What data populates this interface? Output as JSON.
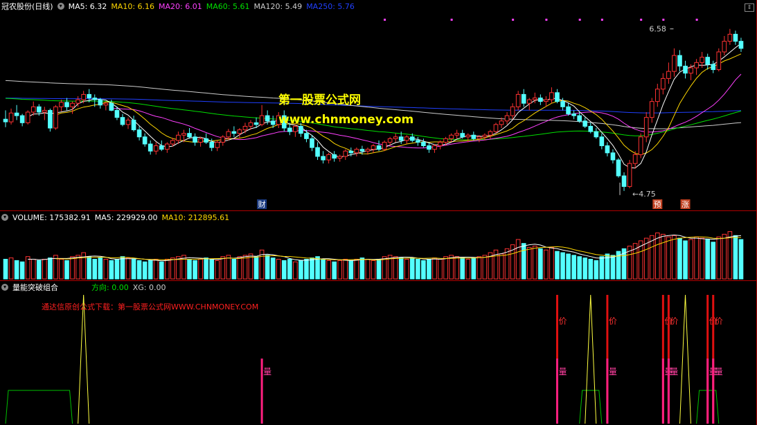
{
  "main": {
    "stock_name": "冠农股份(日线)",
    "ma": [
      {
        "label": "MA5: 6.32",
        "color": "#ffffff"
      },
      {
        "label": "MA10: 6.16",
        "color": "#ffd700"
      },
      {
        "label": "MA20: 6.01",
        "color": "#ff40ff"
      },
      {
        "label": "MA60: 5.61",
        "color": "#00e000"
      },
      {
        "label": "MA120: 5.49",
        "color": "#cccccc"
      },
      {
        "label": "MA250: 5.76",
        "color": "#2040ff"
      }
    ],
    "watermark_title": "第一股票公式网",
    "watermark_url": "www.chnmoney.com",
    "high_label": "6.58",
    "low_label": "4.75",
    "markers": [
      {
        "text": "财",
        "x_index": 46
      },
      {
        "text": "预",
        "x_index": 117
      },
      {
        "text": "涨",
        "x_index": 122
      }
    ]
  },
  "volume": {
    "label": "VOLUME: 175382.91",
    "ma5": "MA5: 229929.00",
    "ma10": "MA10: 212895.61"
  },
  "indicator": {
    "name": "量能突破组合",
    "dir_label": "方向: 0.00",
    "xg_label": "XG: 0.00",
    "notice": "通达信原创公式下载：第一股票公式网WWW.CHNMONEY.COM",
    "price_glyph": "价",
    "volume_glyph": "量"
  },
  "colors": {
    "up": "#ff3232",
    "down": "#54ffff",
    "ma5": "#ffffff",
    "ma10": "#ffd700",
    "ma20": "#ff40ff",
    "ma60": "#00e000",
    "ma120": "#cccccc",
    "ma250": "#2040ff"
  },
  "chart_data": {
    "type": "candlestick",
    "ylim": [
      4.6,
      6.75
    ],
    "candles": [
      [
        5.56,
        5.66,
        5.47,
        5.53
      ],
      [
        5.53,
        5.68,
        5.5,
        5.63
      ],
      [
        5.63,
        5.72,
        5.55,
        5.6
      ],
      [
        5.6,
        5.62,
        5.48,
        5.52
      ],
      [
        5.52,
        5.66,
        5.5,
        5.64
      ],
      [
        5.64,
        5.76,
        5.6,
        5.7
      ],
      [
        5.7,
        5.73,
        5.6,
        5.64
      ],
      [
        5.64,
        5.7,
        5.55,
        5.66
      ],
      [
        5.66,
        5.68,
        5.42,
        5.46
      ],
      [
        5.46,
        5.72,
        5.44,
        5.7
      ],
      [
        5.7,
        5.78,
        5.65,
        5.75
      ],
      [
        5.75,
        5.8,
        5.66,
        5.7
      ],
      [
        5.7,
        5.76,
        5.62,
        5.74
      ],
      [
        5.74,
        5.82,
        5.7,
        5.78
      ],
      [
        5.78,
        5.88,
        5.74,
        5.84
      ],
      [
        5.84,
        5.9,
        5.75,
        5.8
      ],
      [
        5.8,
        5.84,
        5.7,
        5.78
      ],
      [
        5.78,
        5.8,
        5.68,
        5.72
      ],
      [
        5.72,
        5.76,
        5.66,
        5.74
      ],
      [
        5.74,
        5.78,
        5.65,
        5.66
      ],
      [
        5.66,
        5.7,
        5.55,
        5.58
      ],
      [
        5.58,
        5.62,
        5.48,
        5.5
      ],
      [
        5.5,
        5.58,
        5.45,
        5.55
      ],
      [
        5.55,
        5.6,
        5.42,
        5.44
      ],
      [
        5.44,
        5.48,
        5.32,
        5.36
      ],
      [
        5.36,
        5.4,
        5.25,
        5.28
      ],
      [
        5.28,
        5.32,
        5.16,
        5.2
      ],
      [
        5.2,
        5.3,
        5.16,
        5.26
      ],
      [
        5.26,
        5.32,
        5.2,
        5.22
      ],
      [
        5.22,
        5.3,
        5.18,
        5.28
      ],
      [
        5.28,
        5.35,
        5.25,
        5.32
      ],
      [
        5.32,
        5.42,
        5.28,
        5.38
      ],
      [
        5.38,
        5.44,
        5.3,
        5.4
      ],
      [
        5.4,
        5.46,
        5.34,
        5.36
      ],
      [
        5.36,
        5.4,
        5.26,
        5.3
      ],
      [
        5.3,
        5.36,
        5.25,
        5.34
      ],
      [
        5.34,
        5.4,
        5.28,
        5.3
      ],
      [
        5.3,
        5.34,
        5.2,
        5.24
      ],
      [
        5.24,
        5.32,
        5.2,
        5.3
      ],
      [
        5.3,
        5.38,
        5.26,
        5.36
      ],
      [
        5.36,
        5.45,
        5.32,
        5.42
      ],
      [
        5.42,
        5.48,
        5.36,
        5.4
      ],
      [
        5.4,
        5.46,
        5.34,
        5.44
      ],
      [
        5.44,
        5.52,
        5.4,
        5.48
      ],
      [
        5.48,
        5.55,
        5.44,
        5.52
      ],
      [
        5.52,
        5.58,
        5.46,
        5.5
      ],
      [
        5.5,
        5.72,
        5.48,
        5.6
      ],
      [
        5.6,
        5.66,
        5.5,
        5.54
      ],
      [
        5.54,
        5.6,
        5.46,
        5.5
      ],
      [
        5.5,
        5.64,
        5.46,
        5.6
      ],
      [
        5.6,
        5.66,
        5.42,
        5.46
      ],
      [
        5.46,
        5.52,
        5.38,
        5.42
      ],
      [
        5.42,
        5.5,
        5.36,
        5.48
      ],
      [
        5.48,
        5.52,
        5.36,
        5.4
      ],
      [
        5.4,
        5.44,
        5.3,
        5.34
      ],
      [
        5.34,
        5.38,
        5.2,
        5.24
      ],
      [
        5.24,
        5.3,
        5.1,
        5.14
      ],
      [
        5.14,
        5.2,
        5.06,
        5.1
      ],
      [
        5.1,
        5.18,
        5.06,
        5.16
      ],
      [
        5.16,
        5.2,
        5.08,
        5.12
      ],
      [
        5.12,
        5.16,
        5.08,
        5.14
      ],
      [
        5.14,
        5.22,
        5.1,
        5.2
      ],
      [
        5.2,
        5.24,
        5.14,
        5.18
      ],
      [
        5.18,
        5.24,
        5.14,
        5.22
      ],
      [
        5.22,
        5.26,
        5.16,
        5.2
      ],
      [
        5.2,
        5.24,
        5.16,
        5.22
      ],
      [
        5.22,
        5.28,
        5.18,
        5.26
      ],
      [
        5.26,
        5.32,
        5.2,
        5.22
      ],
      [
        5.22,
        5.32,
        5.2,
        5.3
      ],
      [
        5.3,
        5.36,
        5.26,
        5.34
      ],
      [
        5.34,
        5.4,
        5.3,
        5.36
      ],
      [
        5.36,
        5.42,
        5.28,
        5.32
      ],
      [
        5.32,
        5.38,
        5.28,
        5.36
      ],
      [
        5.36,
        5.4,
        5.3,
        5.32
      ],
      [
        5.32,
        5.36,
        5.26,
        5.3
      ],
      [
        5.3,
        5.34,
        5.24,
        5.26
      ],
      [
        5.26,
        5.3,
        5.18,
        5.22
      ],
      [
        5.22,
        5.28,
        5.18,
        5.26
      ],
      [
        5.26,
        5.32,
        5.22,
        5.3
      ],
      [
        5.3,
        5.36,
        5.26,
        5.34
      ],
      [
        5.34,
        5.4,
        5.3,
        5.38
      ],
      [
        5.38,
        5.44,
        5.34,
        5.4
      ],
      [
        5.4,
        5.44,
        5.34,
        5.36
      ],
      [
        5.36,
        5.4,
        5.3,
        5.38
      ],
      [
        5.38,
        5.42,
        5.32,
        5.34
      ],
      [
        5.34,
        5.38,
        5.3,
        5.36
      ],
      [
        5.36,
        5.4,
        5.32,
        5.38
      ],
      [
        5.38,
        5.44,
        5.34,
        5.42
      ],
      [
        5.42,
        5.52,
        5.4,
        5.5
      ],
      [
        5.5,
        5.58,
        5.46,
        5.54
      ],
      [
        5.54,
        5.64,
        5.5,
        5.6
      ],
      [
        5.6,
        5.74,
        5.56,
        5.7
      ],
      [
        5.7,
        5.88,
        5.66,
        5.84
      ],
      [
        5.84,
        5.9,
        5.7,
        5.74
      ],
      [
        5.74,
        5.8,
        5.66,
        5.78
      ],
      [
        5.78,
        5.86,
        5.74,
        5.8
      ],
      [
        5.8,
        5.84,
        5.72,
        5.76
      ],
      [
        5.76,
        5.82,
        5.7,
        5.78
      ],
      [
        5.78,
        5.92,
        5.74,
        5.86
      ],
      [
        5.86,
        5.9,
        5.74,
        5.76
      ],
      [
        5.76,
        5.8,
        5.66,
        5.7
      ],
      [
        5.7,
        5.74,
        5.6,
        5.62
      ],
      [
        5.62,
        5.66,
        5.56,
        5.6
      ],
      [
        5.6,
        5.64,
        5.52,
        5.54
      ],
      [
        5.54,
        5.58,
        5.46,
        5.48
      ],
      [
        5.48,
        5.52,
        5.4,
        5.42
      ],
      [
        5.42,
        5.46,
        5.34,
        5.36
      ],
      [
        5.36,
        5.4,
        5.22,
        5.26
      ],
      [
        5.26,
        5.3,
        5.14,
        5.18
      ],
      [
        5.18,
        5.22,
        5.06,
        5.1
      ],
      [
        5.1,
        5.12,
        4.9,
        4.92
      ],
      [
        4.92,
        4.96,
        4.75,
        4.8
      ],
      [
        4.8,
        5.1,
        4.78,
        5.06
      ],
      [
        5.06,
        5.2,
        5.0,
        5.16
      ],
      [
        5.16,
        5.4,
        5.12,
        5.36
      ],
      [
        5.36,
        5.64,
        5.3,
        5.58
      ],
      [
        5.58,
        5.8,
        5.52,
        5.76
      ],
      [
        5.76,
        5.96,
        5.7,
        5.9
      ],
      [
        5.9,
        6.08,
        5.84,
        6.02
      ],
      [
        6.02,
        6.2,
        5.96,
        6.1
      ],
      [
        6.1,
        6.36,
        6.04,
        6.28
      ],
      [
        6.28,
        6.34,
        6.1,
        6.16
      ],
      [
        6.16,
        6.22,
        6.02,
        6.08
      ],
      [
        6.08,
        6.18,
        6.0,
        6.14
      ],
      [
        6.14,
        6.24,
        6.06,
        6.2
      ],
      [
        6.2,
        6.32,
        6.14,
        6.26
      ],
      [
        6.26,
        6.3,
        6.12,
        6.18
      ],
      [
        6.18,
        6.22,
        6.08,
        6.12
      ],
      [
        6.12,
        6.36,
        6.1,
        6.32
      ],
      [
        6.32,
        6.5,
        6.28,
        6.44
      ],
      [
        6.44,
        6.58,
        6.4,
        6.52
      ],
      [
        6.52,
        6.56,
        6.4,
        6.44
      ],
      [
        6.44,
        6.48,
        6.32,
        6.36
      ]
    ],
    "volumes": [
      30,
      32,
      28,
      26,
      34,
      30,
      28,
      30,
      32,
      36,
      30,
      28,
      34,
      36,
      40,
      34,
      30,
      32,
      30,
      28,
      30,
      34,
      32,
      30,
      28,
      26,
      28,
      30,
      26,
      30,
      32,
      34,
      36,
      30,
      28,
      30,
      32,
      30,
      28,
      34,
      36,
      30,
      34,
      36,
      38,
      34,
      44,
      36,
      32,
      30,
      28,
      30,
      26,
      28,
      30,
      32,
      34,
      30,
      28,
      26,
      28,
      30,
      28,
      30,
      32,
      30,
      28,
      30,
      34,
      36,
      34,
      32,
      30,
      32,
      30,
      28,
      30,
      32,
      30,
      34,
      36,
      34,
      32,
      30,
      32,
      34,
      36,
      40,
      44,
      38,
      46,
      52,
      60,
      54,
      48,
      50,
      46,
      44,
      48,
      42,
      40,
      38,
      36,
      34,
      32,
      30,
      28,
      34,
      38,
      36,
      42,
      46,
      50,
      54,
      58,
      62,
      66,
      70,
      68,
      64,
      66,
      62,
      58,
      60,
      64,
      62,
      60,
      56,
      64,
      68,
      72,
      66,
      60
    ],
    "indicator_spikes": {
      "yellow_triangles": [
        14,
        105,
        122
      ],
      "red_price_bars": [
        99,
        108,
        118,
        119,
        126,
        127
      ],
      "magenta_volume_bars": [
        46,
        99,
        108,
        118,
        119,
        126,
        127
      ],
      "green_plateaus": [
        [
          0,
          12
        ],
        [
          103,
          107
        ],
        [
          124,
          128
        ]
      ]
    }
  }
}
